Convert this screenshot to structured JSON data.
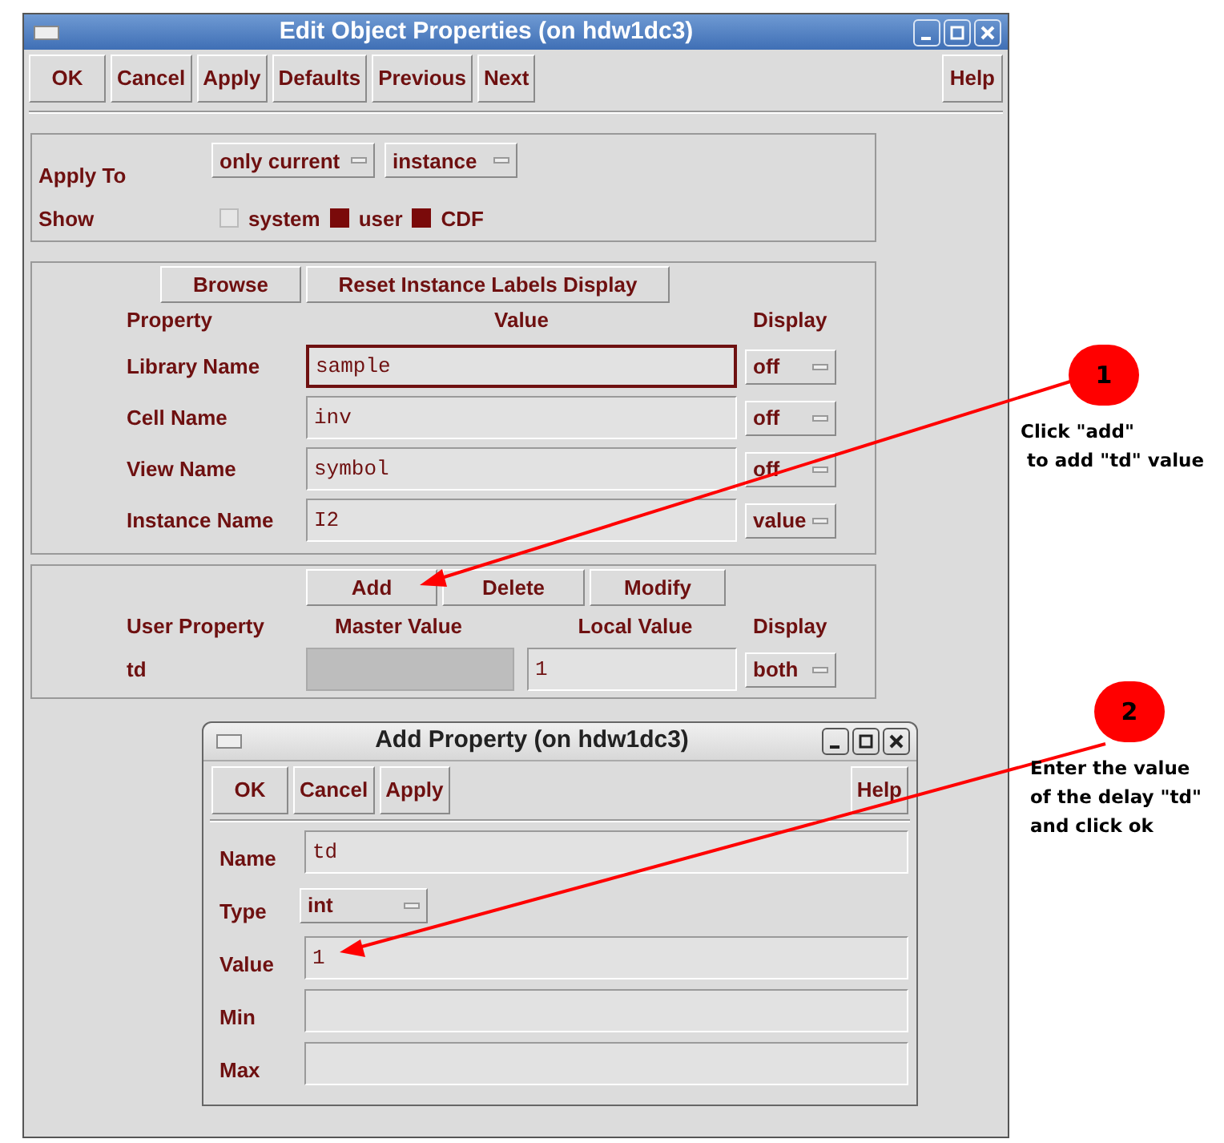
{
  "window": {
    "title": "Edit Object Properties (on hdw1dc3)"
  },
  "toolbar": {
    "buttons": [
      "OK",
      "Cancel",
      "Apply",
      "Defaults",
      "Previous",
      "Next"
    ],
    "help": "Help"
  },
  "apply_to": {
    "label": "Apply To",
    "options": [
      "only current",
      "instance"
    ]
  },
  "show": {
    "label": "Show",
    "items": [
      {
        "label": "system",
        "checked": false
      },
      {
        "label": "user",
        "checked": true
      },
      {
        "label": "CDF",
        "checked": true
      }
    ]
  },
  "properties": {
    "buttons": [
      "Browse",
      "Reset Instance Labels Display"
    ],
    "columns": [
      "Property",
      "Value",
      "Display"
    ],
    "rows": [
      {
        "name": "Library Name",
        "value": "sample",
        "display": "off",
        "focused": true
      },
      {
        "name": "Cell Name",
        "value": "inv",
        "display": "off",
        "focused": false
      },
      {
        "name": "View Name",
        "value": "symbol",
        "display": "off",
        "focused": false
      },
      {
        "name": "Instance Name",
        "value": "I2",
        "display": "value",
        "focused": false
      }
    ]
  },
  "user_properties": {
    "buttons": [
      "Add",
      "Delete",
      "Modify"
    ],
    "columns": [
      "User Property",
      "Master Value",
      "Local Value",
      "Display"
    ],
    "rows": [
      {
        "name": "td",
        "local_value": "1",
        "display": "both"
      }
    ]
  },
  "dialog": {
    "title": "Add Property (on hdw1dc3)",
    "buttons": [
      "OK",
      "Cancel",
      "Apply"
    ],
    "help": "Help",
    "fields": [
      {
        "label": "Name",
        "kind": "text",
        "value": "td"
      },
      {
        "label": "Type",
        "kind": "select",
        "value": "int"
      },
      {
        "label": "Value",
        "kind": "text",
        "value": "1"
      },
      {
        "label": "Min",
        "kind": "text"
      },
      {
        "label": "Max",
        "kind": "text"
      }
    ]
  },
  "callouts": [
    {
      "number": "1",
      "lines": [
        "Click \"add\"",
        " to add \"td\" value"
      ]
    },
    {
      "number": "2",
      "lines": [
        "Enter the value",
        "of the delay \"td\"",
        "and click ok"
      ]
    }
  ]
}
